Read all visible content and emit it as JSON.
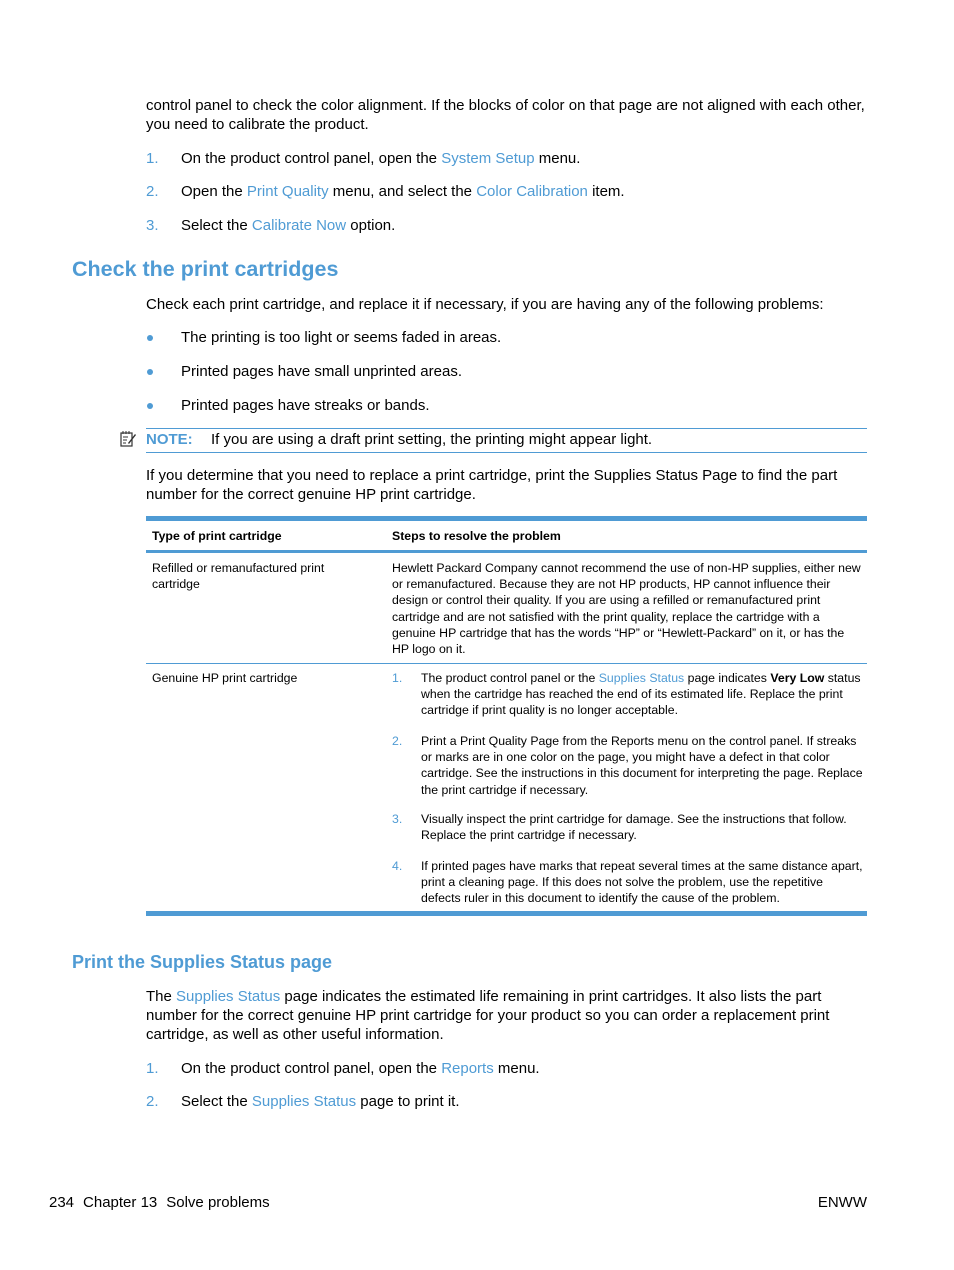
{
  "intro": {
    "para": "control panel to check the color alignment. If the blocks of color on that page are not aligned with each other, you need to calibrate the product.",
    "steps": [
      {
        "num": "1.",
        "pre": "On the product control panel, open the ",
        "link": "System Setup",
        "post": " menu."
      },
      {
        "num": "2.",
        "pre": "Open the ",
        "link": "Print Quality",
        "mid": " menu, and select the ",
        "link2": "Color Calibration",
        "post": " item."
      },
      {
        "num": "3.",
        "pre": "Select the ",
        "link": "Calibrate Now",
        "post": " option."
      }
    ]
  },
  "section1": {
    "heading": "Check the print cartridges",
    "intro": "Check each print cartridge, and replace it if necessary, if you are having any of the following problems:",
    "bullets": [
      "The printing is too light or seems faded in areas.",
      "Printed pages have small unprinted areas.",
      "Printed pages have streaks or bands."
    ],
    "note": {
      "icon": "note-icon",
      "label": "NOTE:",
      "text": "If you are using a draft print setting, the printing might appear light."
    },
    "para2": "If you determine that you need to replace a print cartridge, print the Supplies Status Page to find the part number for the correct genuine HP print cartridge.",
    "table": {
      "headers": [
        "Type of print cartridge",
        "Steps to resolve the problem"
      ],
      "rows": [
        {
          "type": "Refilled or remanufactured print cartridge",
          "text": "Hewlett Packard Company cannot recommend the use of non-HP supplies, either new or remanufactured. Because they are not HP products, HP cannot influence their design or control their quality. If you are using a refilled or remanufactured print cartridge and are not satisfied with the print quality, replace the cartridge with a genuine HP cartridge that has the words “HP” or “Hewlett-Packard” on it, or has the HP logo on it."
        },
        {
          "type": "Genuine HP print cartridge",
          "steps": [
            {
              "num": "1.",
              "pre": "The product control panel or the ",
              "link": "Supplies Status",
              "mid": " page indicates ",
              "bold": "Very Low",
              "post": " status when the cartridge has reached the end of its estimated life. Replace the print cartridge if print quality is no longer acceptable."
            },
            {
              "num": "2.",
              "text": "Print a Print Quality Page from the Reports menu on the control panel. If streaks or marks are in one color on the page, you might have a defect in that color cartridge. See the instructions in this document for interpreting the page. Replace the print cartridge if necessary."
            },
            {
              "num": "3.",
              "text": "Visually inspect the print cartridge for damage. See the instructions that follow. Replace the print cartridge if necessary."
            },
            {
              "num": "4.",
              "text": "If printed pages have marks that repeat several times at the same distance apart, print a cleaning page. If this does not solve the problem, use the repetitive defects ruler in this document to identify the cause of the problem."
            }
          ]
        }
      ]
    }
  },
  "section2": {
    "heading": "Print the Supplies Status page",
    "para_pre": "The ",
    "para_link": "Supplies Status",
    "para_post": " page indicates the estimated life remaining in print cartridges. It also lists the part number for the correct genuine HP print cartridge for your product so you can order a replacement print cartridge, as well as other useful information.",
    "steps": [
      {
        "num": "1.",
        "pre": "On the product control panel, open the ",
        "link": "Reports",
        "post": " menu."
      },
      {
        "num": "2.",
        "pre": "Select the ",
        "link": "Supplies Status",
        "post": " page to print it."
      }
    ]
  },
  "footer": {
    "page_number": "234",
    "chapter": "Chapter 13",
    "chapter_title": "Solve problems",
    "right": "ENWW"
  },
  "colors": {
    "accent": "#4f9bd4",
    "text": "#000000"
  }
}
